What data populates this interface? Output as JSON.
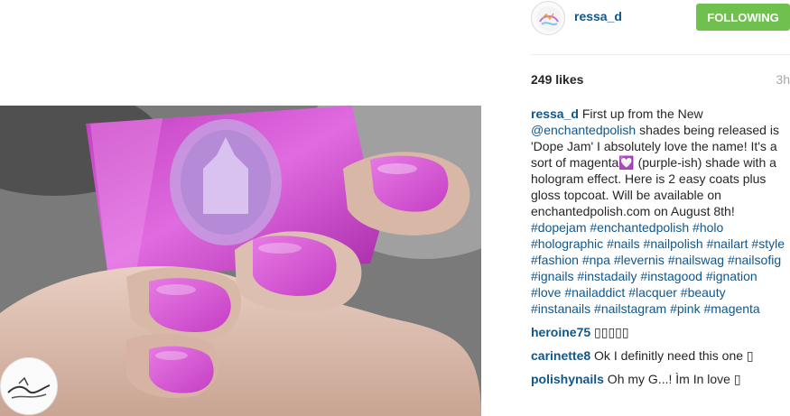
{
  "post": {
    "username": "ressa_d",
    "follow_label": "FOLLOWING",
    "likes": "249 likes",
    "time": "3h"
  },
  "caption": {
    "username": "ressa_d",
    "text_1": " First up from the New ",
    "mention": "@enchantedpolish",
    "text_2": " shades being released is 'Dope Jam' I absolutely love the name! It's a sort of magenta",
    "heart": "💟",
    "text_3": " (purple-ish) shade with a hologram effect. Here is 2 easy coats plus gloss topcoat. Will be available on enchantedpolish.com on August 8th!",
    "hashtags": [
      "#dopejam",
      "#enchantedpolish",
      "#holo",
      "#holographic",
      "#nails",
      "#nailpolish",
      "#nailart",
      "#style",
      "#fashion",
      "#npa",
      "#levernis",
      "#nailswag",
      "#nailsofig",
      "#ignails",
      "#instadaily",
      "#instagood",
      "#ignation",
      "#love",
      "#nailaddict",
      "#lacquer",
      "#beauty",
      "#instanails",
      "#nailstagram",
      "#pink",
      "#magenta"
    ]
  },
  "comments": [
    {
      "username": "heroine75",
      "text": " ▯▯▯▯▯"
    },
    {
      "username": "carinette8",
      "text": " Ok I definitly need this one ▯"
    },
    {
      "username": "polishynails",
      "text": " Oh my G...! Ìm In love ▯"
    }
  ],
  "colors": {
    "username_blue": "#125688",
    "follow_green": "#70c050",
    "polish_magenta": "#d94fd0"
  },
  "icons": {
    "avatar": "profile-avatar",
    "watermark": "signature-watermark"
  }
}
